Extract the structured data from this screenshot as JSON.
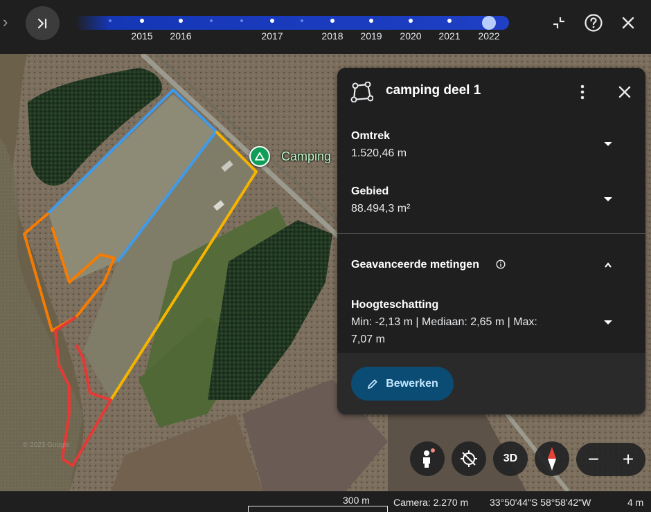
{
  "timeline": {
    "years": [
      "2015",
      "2016",
      "2017",
      "2018",
      "2019",
      "2020",
      "2021",
      "2022"
    ],
    "selected_year": "2022"
  },
  "icons": {
    "expand": "chevron-right-icon",
    "skip_to_end": "skip-to-end-icon",
    "collapse": "collapse-icon",
    "help": "help-circle-icon",
    "close": "close-icon"
  },
  "map": {
    "poi_label": "Camping",
    "watermark": "© 2023 Google",
    "polygon_colors": {
      "blue": "#3f9bea",
      "yellow": "#f5b400",
      "orange": "#f57c00",
      "red": "#e53935"
    }
  },
  "panel": {
    "title": "camping deel 1",
    "sections": [
      {
        "label": "Omtrek",
        "value": "1.520,46 m"
      },
      {
        "label": "Gebied",
        "value": "88.494,3 m²"
      }
    ],
    "advanced": {
      "label": "Geavanceerde metingen",
      "height_label": "Hoogteschatting",
      "height_value_line1": "Min: -2,13 m | Mediaan: 2,65 m | Max:",
      "height_value_line2": "7,07 m"
    },
    "edit_label": "Bewerken"
  },
  "controls": {
    "three_d": "3D",
    "zoom_out": "−",
    "zoom_in": "+"
  },
  "status": {
    "scale": "300 m",
    "camera": "Camera: 2.270 m",
    "coords": "33°50'44\"S 58°58'42\"W",
    "elevation": "4 m"
  }
}
